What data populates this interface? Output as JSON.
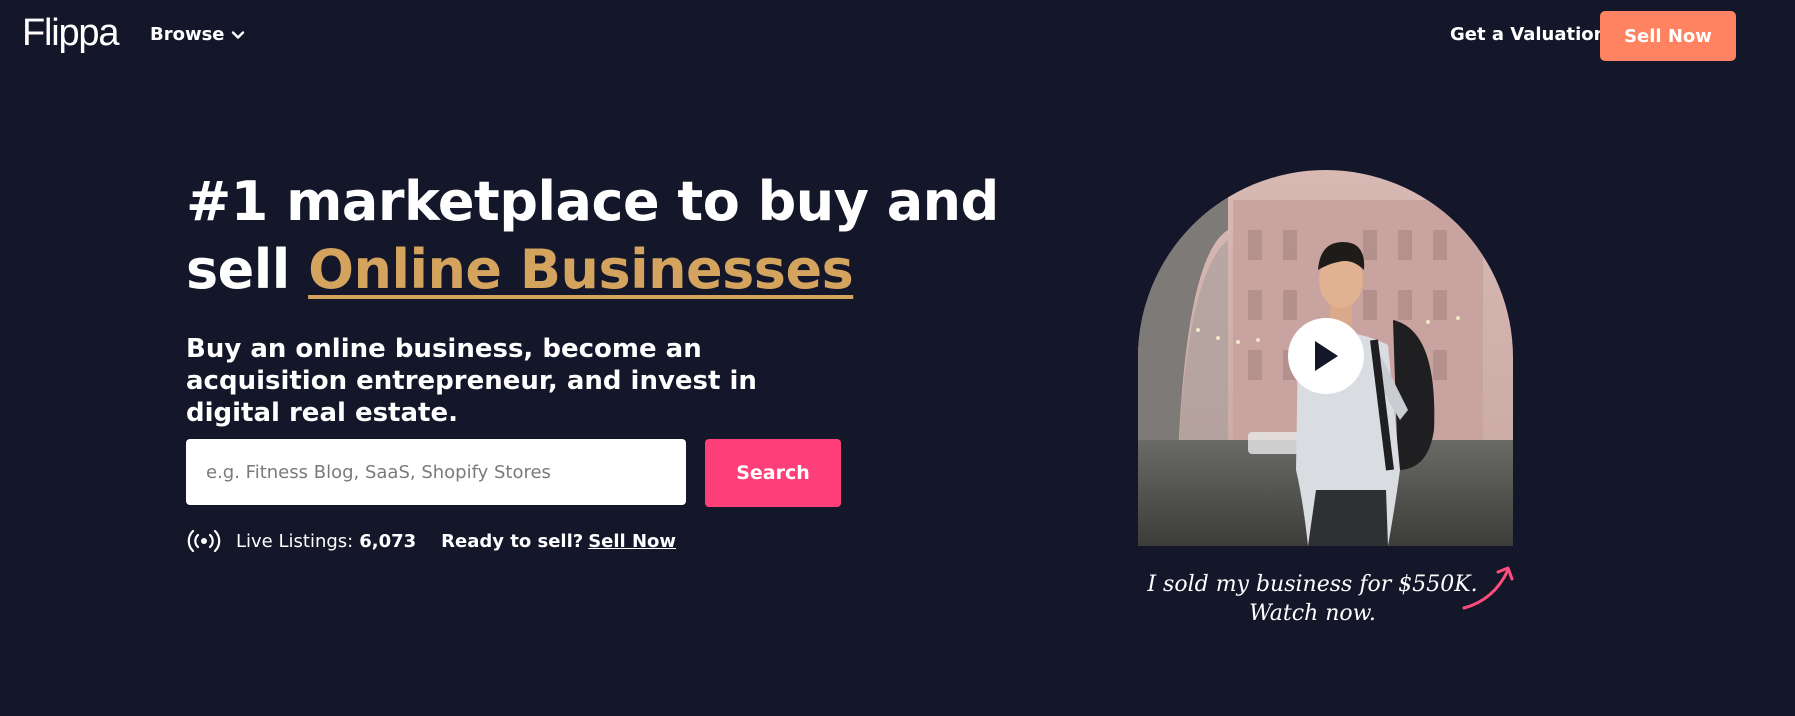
{
  "header": {
    "logo": "Flippa",
    "browse_label": "Browse",
    "valuation_label": "Get a Valuation",
    "sell_now_label": "Sell Now"
  },
  "hero": {
    "headline_line1": "#1 marketplace to buy and",
    "headline_word": "sell",
    "headline_accent": "Online Businesses",
    "subhead": "Buy an online business, become an acquisition entrepreneur, and invest in digital real estate."
  },
  "search": {
    "placeholder": "e.g. Fitness Blog, SaaS, Shopify Stores",
    "value": "",
    "button_label": "Search"
  },
  "stats": {
    "live_label": "Live Listings:",
    "live_count": "6,073",
    "ready_label": "Ready to sell?",
    "ready_link": "Sell Now"
  },
  "video": {
    "caption_line1": "I sold my business for $550K.",
    "caption_line2": "Watch now."
  },
  "colors": {
    "background": "#14162a",
    "accent_gold": "#d4a35e",
    "sell_button": "#ff8360",
    "search_button": "#ff3f7a",
    "arrow": "#ff4d7d"
  },
  "icons": {
    "browse": "chevron-down-icon",
    "live": "broadcast-icon",
    "play": "play-icon",
    "caption": "curved-arrow-icon"
  }
}
